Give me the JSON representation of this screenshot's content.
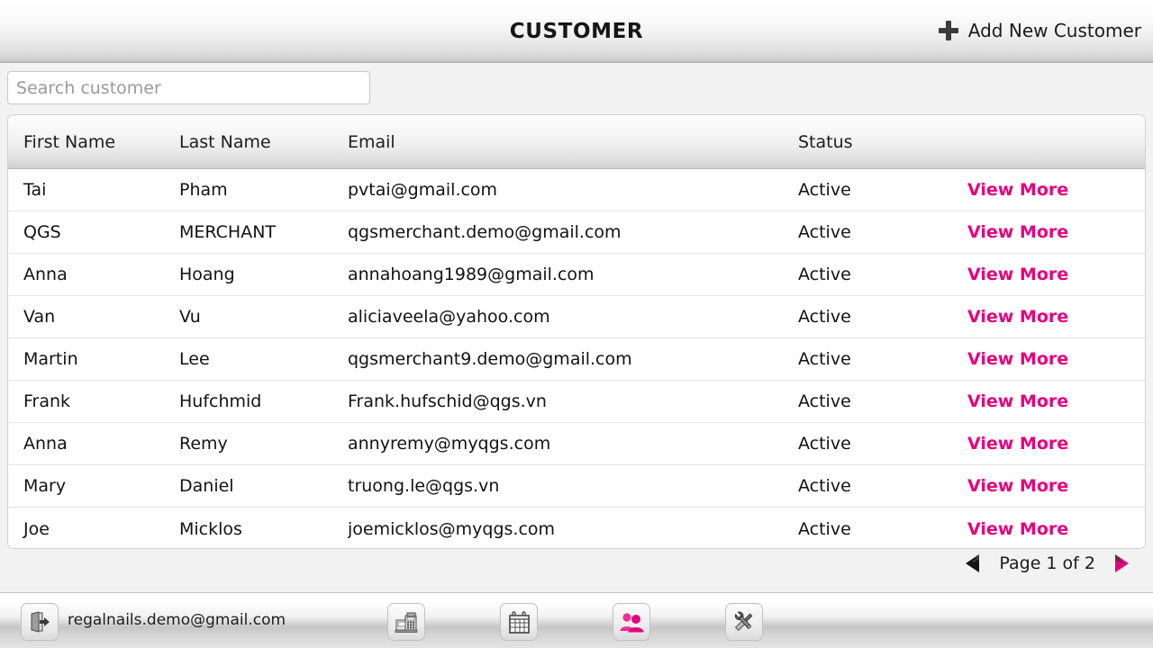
{
  "header": {
    "title": "CUSTOMER",
    "add_new_label": "Add New Customer",
    "add_new_icon": "plus-icon"
  },
  "search": {
    "placeholder": "Search customer",
    "value": "",
    "icon": "search-icon"
  },
  "table": {
    "columns": [
      "First Name",
      "Last Name",
      "Email",
      "Status"
    ],
    "action_label": "View More",
    "rows": [
      {
        "first": "Tai",
        "last": "Pham",
        "email": "pvtai@gmail.com",
        "status": "Active",
        "action": "View More"
      },
      {
        "first": "QGS",
        "last": "MERCHANT",
        "email": "qgsmerchant.demo@gmail.com",
        "status": "Active",
        "action": "View More"
      },
      {
        "first": "Anna",
        "last": "Hoang",
        "email": "annahoang1989@gmail.com",
        "status": "Active",
        "action": "View More"
      },
      {
        "first": "Van",
        "last": "Vu",
        "email": "aliciaveela@yahoo.com",
        "status": "Active",
        "action": "View More"
      },
      {
        "first": "Martin",
        "last": "Lee",
        "email": "qgsmerchant9.demo@gmail.com",
        "status": "Active",
        "action": "View More"
      },
      {
        "first": "Frank",
        "last": "Hufchmid",
        "email": "Frank.hufschid@qgs.vn",
        "status": "Active",
        "action": "View More"
      },
      {
        "first": "Anna",
        "last": "Remy",
        "email": "annyremy@myqgs.com",
        "status": "Active",
        "action": "View More"
      },
      {
        "first": "Mary",
        "last": "Daniel",
        "email": "truong.le@qgs.vn",
        "status": "Active",
        "action": "View More"
      },
      {
        "first": "Joe",
        "last": "Micklos",
        "email": "joemicklos@myqgs.com",
        "status": "Active",
        "action": "View More"
      }
    ]
  },
  "pagination": {
    "label": "Page 1 of 2",
    "current_page": 1,
    "total_pages": 2,
    "prev_icon": "chevron-left-icon",
    "next_icon": "chevron-right-icon"
  },
  "bottom_bar": {
    "logout_icon": "logout-door-icon",
    "user_email": "regalnails.demo@gmail.com",
    "tabs": [
      {
        "icon": "cash-register-icon",
        "name": "pos",
        "active": false
      },
      {
        "icon": "calendar-icon",
        "name": "calendar",
        "active": false
      },
      {
        "icon": "customers-icon",
        "name": "customer",
        "active": true
      },
      {
        "icon": "tools-icon",
        "name": "settings",
        "active": false
      }
    ]
  },
  "colors": {
    "accent_pink": "#e6007e",
    "text_primary": "#121212",
    "placeholder": "#9a9a9a"
  }
}
